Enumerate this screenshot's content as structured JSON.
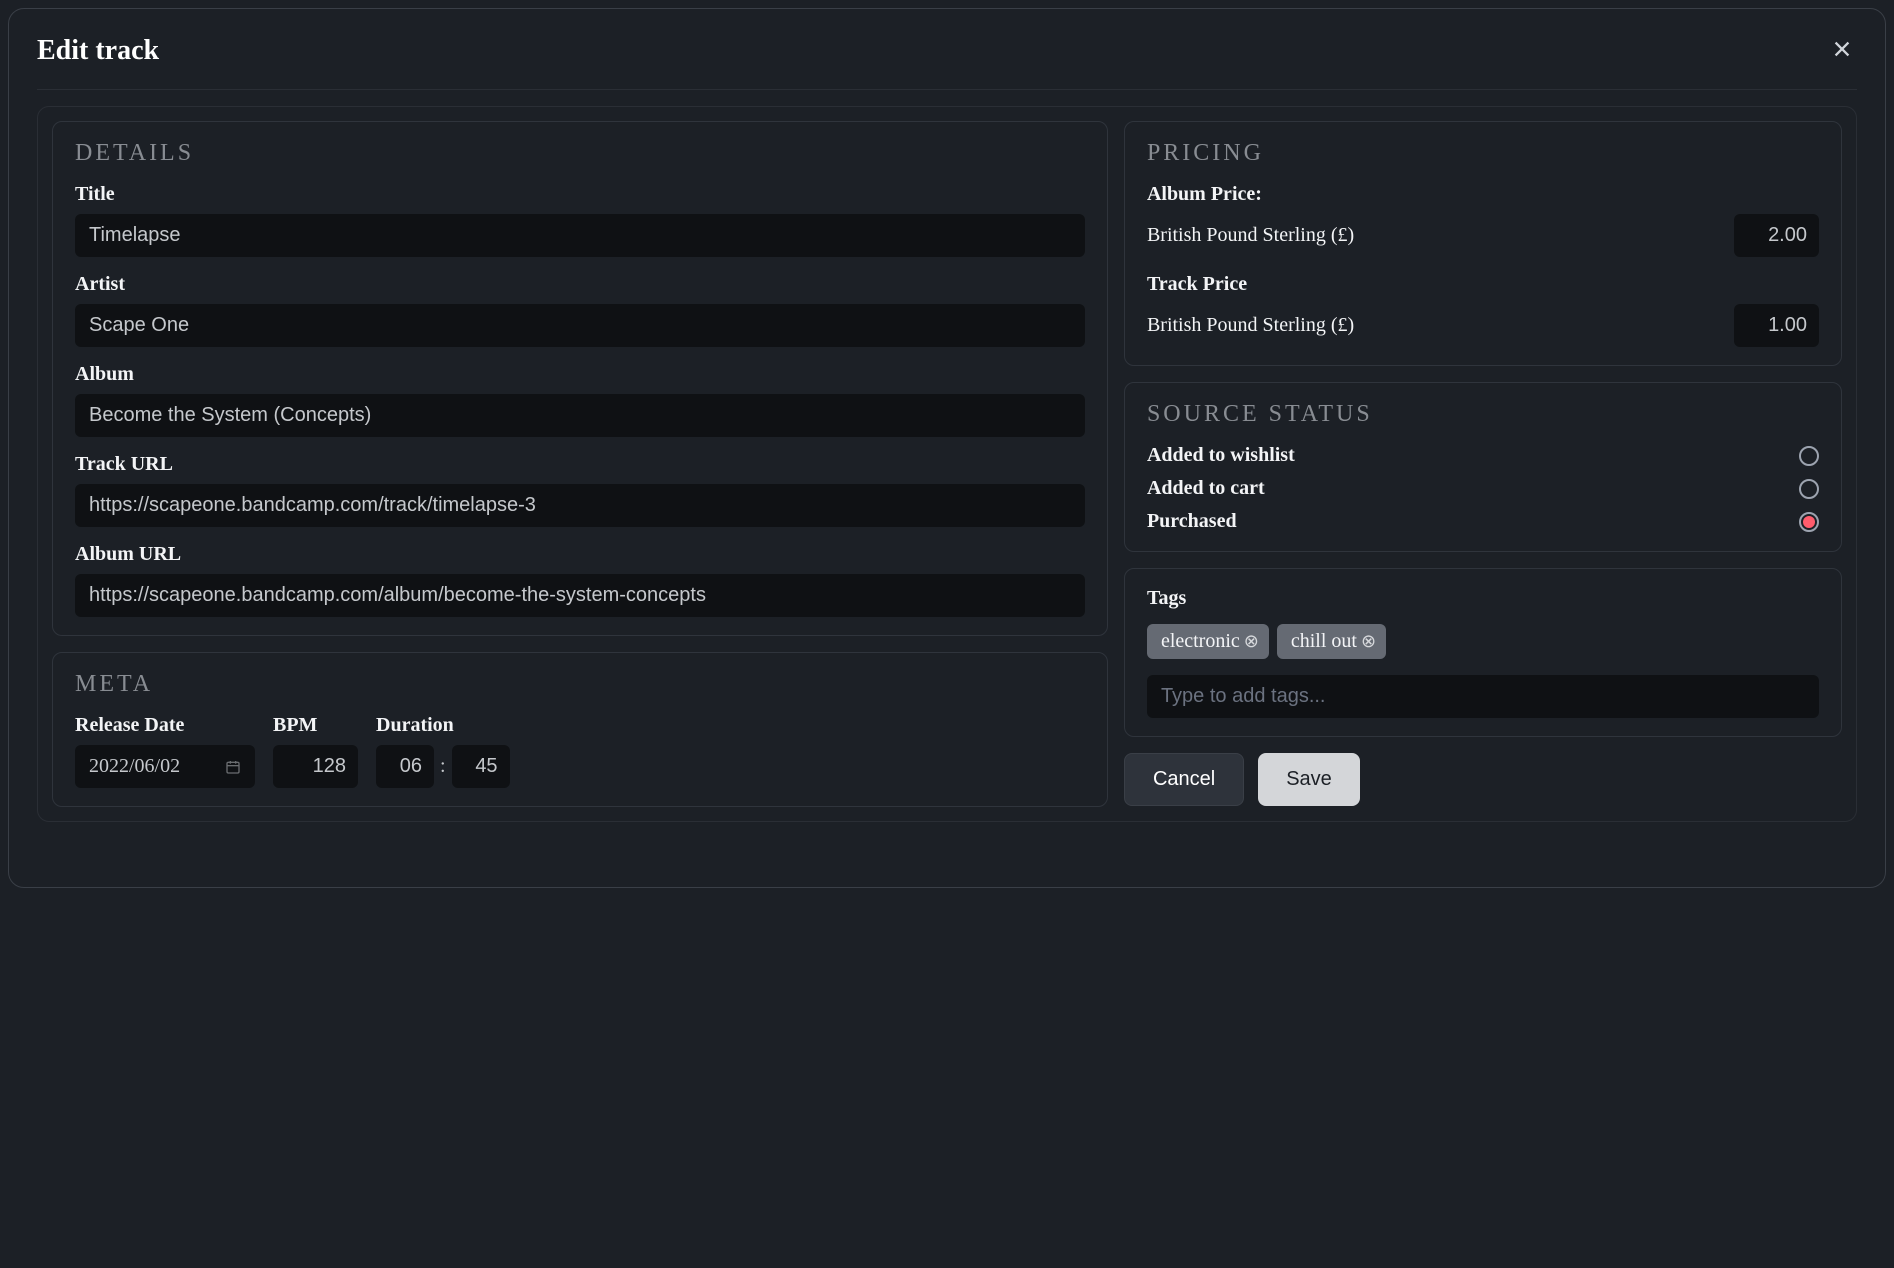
{
  "modal": {
    "title": "Edit track"
  },
  "details": {
    "heading": "DETAILS",
    "title_label": "Title",
    "title_value": "Timelapse",
    "artist_label": "Artist",
    "artist_value": "Scape One",
    "album_label": "Album",
    "album_value": "Become the System (Concepts)",
    "track_url_label": "Track URL",
    "track_url_value": "https://scapeone.bandcamp.com/track/timelapse-3",
    "album_url_label": "Album URL",
    "album_url_value": "https://scapeone.bandcamp.com/album/become-the-system-concepts"
  },
  "meta": {
    "heading": "META",
    "release_date_label": "Release Date",
    "release_date_value": "2022/06/02",
    "bpm_label": "BPM",
    "bpm_value": "128",
    "duration_label": "Duration",
    "duration_min": "06",
    "duration_sec": "45",
    "colon": ":"
  },
  "pricing": {
    "heading": "PRICING",
    "album_pricephenotype_label": "Album Price:",
    "album_price_label": "Album Price:",
    "album_currency": "British Pound Sterling (£)",
    "album_price_value": "2.00",
    "track_price_label": "Track Price",
    "track_currency": "British Pound Sterling (£)",
    "track_price_value": "1.00"
  },
  "source_status": {
    "heading": "SOURCE STATUS",
    "wishlist_label": "Added to wishlist",
    "cart_label": "Added to cart",
    "purchased_label": "Purchased"
  },
  "tags": {
    "heading": "Tags",
    "items": [
      "electronic",
      "chill out"
    ],
    "placeholder": "Type to add tags..."
  },
  "buttons": {
    "cancel": "Cancel",
    "save": "Save"
  }
}
